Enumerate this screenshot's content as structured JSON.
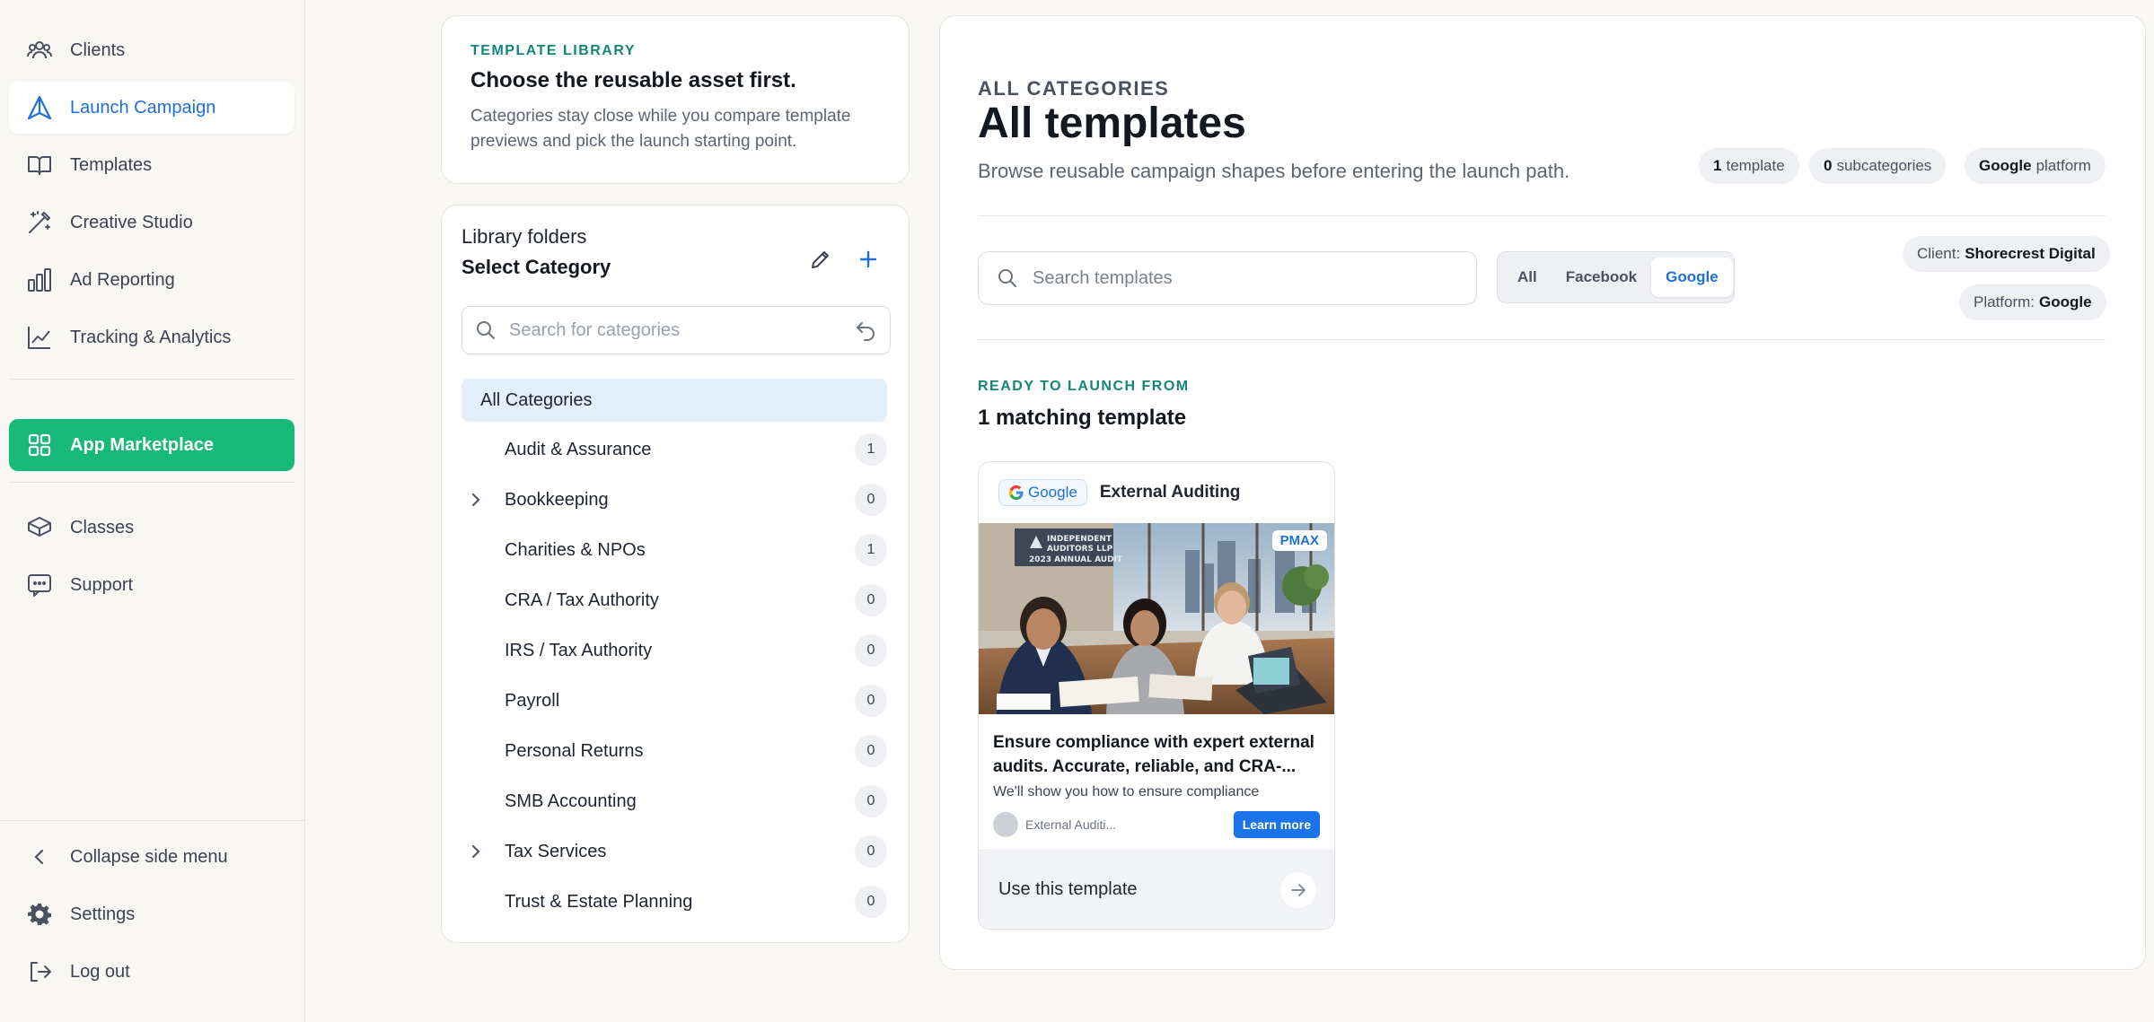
{
  "sidebar": {
    "items": [
      {
        "label": "Clients",
        "icon": "users-icon"
      },
      {
        "label": "Launch Campaign",
        "icon": "triangle-icon"
      },
      {
        "label": "Templates",
        "icon": "book-icon"
      },
      {
        "label": "Creative Studio",
        "icon": "wand-icon"
      },
      {
        "label": "Ad Reporting",
        "icon": "bar-chart-icon"
      },
      {
        "label": "Tracking & Analytics",
        "icon": "line-chart-icon"
      },
      {
        "label": "App Marketplace",
        "icon": "grid-icon"
      },
      {
        "label": "Classes",
        "icon": "graduation-cap-icon"
      },
      {
        "label": "Support",
        "icon": "chat-icon"
      }
    ],
    "footer": {
      "collapse_label": "Collapse side menu",
      "settings_label": "Settings",
      "logout_label": "Log out"
    },
    "active_color": "#1f6fd6",
    "market_color": "#17b978"
  },
  "intro": {
    "eyebrow": "TEMPLATE LIBRARY",
    "title": "Choose the reusable asset first.",
    "description": "Categories stay close while you compare template previews and pick the launch starting point."
  },
  "folders": {
    "label": "Library folders",
    "title": "Select Category",
    "search_placeholder": "Search for categories",
    "all_label": "All Categories",
    "categories": [
      {
        "name": "Audit & Assurance",
        "count": "1",
        "expandable": false
      },
      {
        "name": "Bookkeeping",
        "count": "0",
        "expandable": true
      },
      {
        "name": "Charities & NPOs",
        "count": "1",
        "expandable": false
      },
      {
        "name": "CRA / Tax Authority",
        "count": "0",
        "expandable": false
      },
      {
        "name": "IRS / Tax Authority",
        "count": "0",
        "expandable": false
      },
      {
        "name": "Payroll",
        "count": "0",
        "expandable": false
      },
      {
        "name": "Personal Returns",
        "count": "0",
        "expandable": false
      },
      {
        "name": "SMB Accounting",
        "count": "0",
        "expandable": false
      },
      {
        "name": "Tax Services",
        "count": "0",
        "expandable": true
      },
      {
        "name": "Trust & Estate Planning",
        "count": "0",
        "expandable": false
      }
    ]
  },
  "main": {
    "eyebrow": "ALL CATEGORIES",
    "title": "All templates",
    "description": "Browse reusable campaign shapes before entering the launch path.",
    "stats": [
      {
        "value": "1",
        "label": "template"
      },
      {
        "value": "0",
        "label": "subcategories"
      },
      {
        "value": "Google",
        "label": "platform"
      }
    ],
    "search_placeholder": "Search templates",
    "filters": [
      "All",
      "Facebook",
      "Google"
    ],
    "active_filter": "Google",
    "context": {
      "client_label": "Client:",
      "client_value": "Shorecrest Digital",
      "platform_label": "Platform:",
      "platform_value": "Google"
    },
    "ready_eyebrow": "READY TO LAUNCH FROM",
    "ready_title": "1 matching template"
  },
  "template_card": {
    "platform_badge": "Google",
    "name": "External Auditing",
    "type_badge": "PMAX",
    "image_sign": [
      "INDEPENDENT",
      "AUDITORS LLP",
      "2023 ANNUAL AUDIT"
    ],
    "headline": "Ensure compliance with expert external audits. Accurate, reliable, and CRA-...",
    "subline": "We'll show you how to ensure compliance",
    "brand": "External Auditi...",
    "cta": "Learn more",
    "use_label": "Use this template"
  }
}
